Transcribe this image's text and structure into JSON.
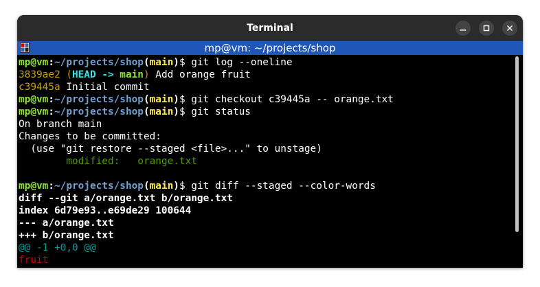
{
  "window": {
    "title": "Terminal"
  },
  "tab": {
    "title": "mp@vm: ~/projects/shop"
  },
  "terminal": {
    "prompt": {
      "user_host": "mp@vm",
      "colon": ":",
      "path": "~/projects/shop",
      "paren_open": "(",
      "branch": "main",
      "paren_close": ")",
      "symbol": "$ "
    },
    "commands": {
      "log": "git log --oneline",
      "checkout": "git checkout c39445a -- orange.txt",
      "status": "git status",
      "diff": "git diff --staged --color-words"
    },
    "log": [
      {
        "hash": "3839ae2",
        "paren_open": " (",
        "head": "HEAD -> ",
        "branch": "main",
        "paren_close": ")",
        "message": " Add orange fruit"
      },
      {
        "hash": "c39445a",
        "message": " Initial commit"
      }
    ],
    "status_output": {
      "line1": "On branch main",
      "line2": "Changes to be committed:",
      "line3": "  (use \"git restore --staged <file>...\" to unstage)",
      "modified": "\tmodified:   orange.txt"
    },
    "diff_output": {
      "header1": "diff --git a/orange.txt b/orange.txt",
      "header2": "index 6d79e93..e69de29 100644",
      "header3": "--- a/orange.txt",
      "header4": "+++ b/orange.txt",
      "hunk": "@@ -1 +0,0 @@",
      "removed": "fruit"
    }
  },
  "colors": {
    "prompt_user": "#8ae234",
    "prompt_path": "#729fcf",
    "branch": "#fce94f",
    "hash": "#c4a000",
    "head": "#34e2e2",
    "modified": "#4e9a06",
    "hunk": "#06989a",
    "removed": "#cc0000",
    "tab_bar": "#1f56b8",
    "title_bar": "#2b2b2b"
  },
  "icons": {
    "tab_icon": "terminal-tab-icon",
    "minimize": "minimize-icon",
    "maximize": "maximize-icon",
    "close": "close-icon"
  }
}
